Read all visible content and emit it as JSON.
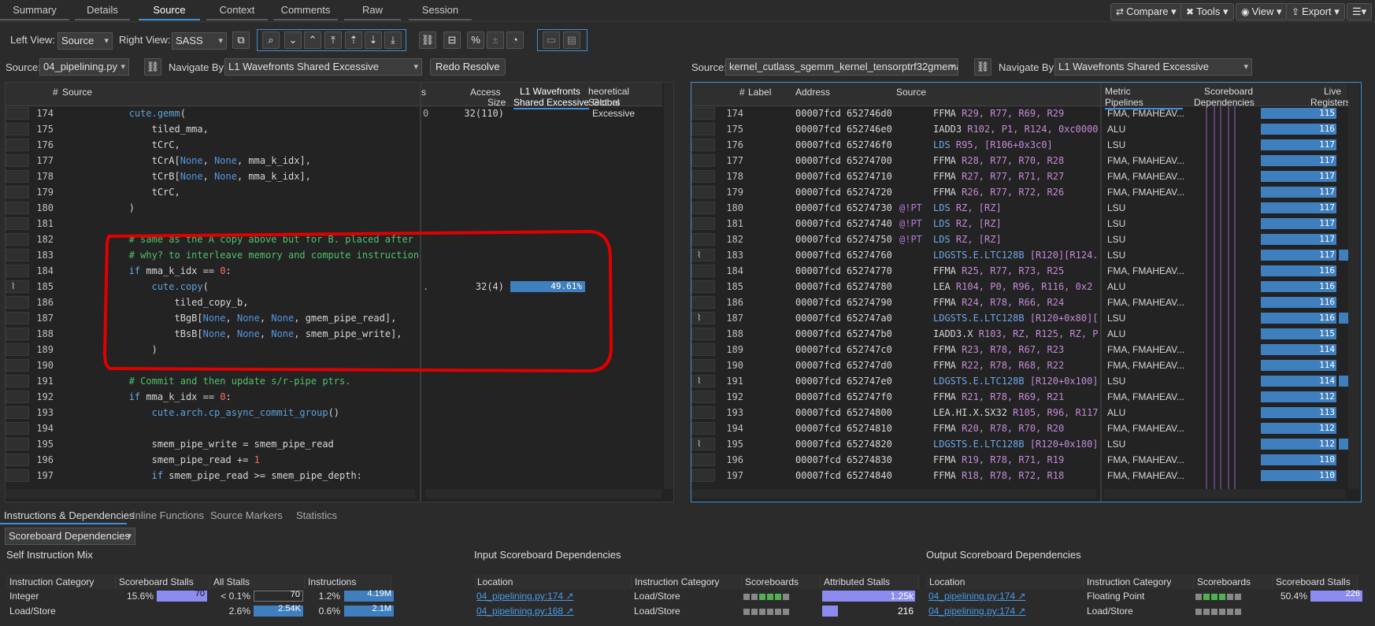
{
  "top_tabs": [
    "Summary",
    "Details",
    "Source",
    "Context",
    "Comments",
    "Raw",
    "Session"
  ],
  "right_buttons": {
    "compare": "Compare",
    "tools": "Tools",
    "view": "View",
    "export": "Export"
  },
  "toolbar": {
    "left_view_label": "Left View:",
    "left_view_value": "Source",
    "right_view_label": "Right View:",
    "right_view_value": "SASS"
  },
  "left_nav": {
    "source_label": "Source:",
    "source_value": "04_pipelining.py",
    "navigate_label": "Navigate By:",
    "navigate_value": "L1 Wavefronts Shared Excessive",
    "redo": "Redo Resolve"
  },
  "right_nav": {
    "source_label": "Source:",
    "source_value": "kernel_cutlass_sgemm_kernel_tensorptrf32gmemal",
    "navigate_label": "Navigate By:",
    "navigate_value": "L1 Wavefronts Shared Excessive"
  },
  "left_headers": {
    "num": "#",
    "source": "Source",
    "access_size_1": "Access",
    "access_size_2": "Size",
    "l1_1": "L1 Wavefronts",
    "l1_2": "Shared Excessive",
    "theo_1": "heoretical Sectors",
    "theo_2": "Global Excessive",
    "s_frag": "s"
  },
  "source_lines": [
    {
      "n": "174",
      "code": [
        [
          "            ",
          ""
        ],
        [
          "cute.gemm",
          "fn"
        ],
        [
          "(",
          ""
        ]
      ],
      "access": "32(110)",
      "frag": "0"
    },
    {
      "n": "175",
      "code": [
        [
          "                tiled_mma,",
          ""
        ]
      ]
    },
    {
      "n": "176",
      "code": [
        [
          "                tCrC,",
          ""
        ]
      ]
    },
    {
      "n": "177",
      "code": [
        [
          "                tCrA[",
          ""
        ],
        [
          "None",
          "none"
        ],
        [
          ", ",
          ""
        ],
        [
          "None",
          "none"
        ],
        [
          ", mma_k_idx],",
          ""
        ]
      ]
    },
    {
      "n": "178",
      "code": [
        [
          "                tCrB[",
          ""
        ],
        [
          "None",
          "none"
        ],
        [
          ", ",
          ""
        ],
        [
          "None",
          "none"
        ],
        [
          ", mma_k_idx],",
          ""
        ]
      ]
    },
    {
      "n": "179",
      "code": [
        [
          "                tCrC,",
          ""
        ]
      ]
    },
    {
      "n": "180",
      "code": [
        [
          "            )",
          ""
        ]
      ]
    },
    {
      "n": "181",
      "code": [
        [
          "",
          ""
        ]
      ]
    },
    {
      "n": "182",
      "code": [
        [
          "            # same as the A copy above but for B. placed after t",
          "cm"
        ]
      ]
    },
    {
      "n": "183",
      "code": [
        [
          "            # why? to interleave memory and compute instructions",
          "cm"
        ]
      ]
    },
    {
      "n": "184",
      "code": [
        [
          "            ",
          ""
        ],
        [
          "if",
          "kw"
        ],
        [
          " mma_k_idx == ",
          ""
        ],
        [
          "0",
          "num"
        ],
        [
          ":",
          ""
        ]
      ]
    },
    {
      "n": "185",
      "code": [
        [
          "                ",
          ""
        ],
        [
          "cute.copy",
          "fn"
        ],
        [
          "(",
          ""
        ]
      ],
      "access": "32(4)",
      "frag": ".",
      "pct": "49.61%",
      "icon": true
    },
    {
      "n": "186",
      "code": [
        [
          "                    tiled_copy_b,",
          ""
        ]
      ]
    },
    {
      "n": "187",
      "code": [
        [
          "                    tBgB[",
          ""
        ],
        [
          "None",
          "none"
        ],
        [
          ", ",
          ""
        ],
        [
          "None",
          "none"
        ],
        [
          ", ",
          ""
        ],
        [
          "None",
          "none"
        ],
        [
          ", gmem_pipe_read],",
          ""
        ]
      ]
    },
    {
      "n": "188",
      "code": [
        [
          "                    tBsB[",
          ""
        ],
        [
          "None",
          "none"
        ],
        [
          ", ",
          ""
        ],
        [
          "None",
          "none"
        ],
        [
          ", ",
          ""
        ],
        [
          "None",
          "none"
        ],
        [
          ", smem_pipe_write],",
          ""
        ]
      ]
    },
    {
      "n": "189",
      "code": [
        [
          "                )",
          ""
        ]
      ]
    },
    {
      "n": "190",
      "code": [
        [
          "",
          ""
        ]
      ]
    },
    {
      "n": "191",
      "code": [
        [
          "            # Commit and then update s/r-pipe ptrs.",
          "cm"
        ]
      ]
    },
    {
      "n": "192",
      "code": [
        [
          "            ",
          ""
        ],
        [
          "if",
          "kw"
        ],
        [
          " mma_k_idx == ",
          ""
        ],
        [
          "0",
          "num"
        ],
        [
          ":",
          ""
        ]
      ]
    },
    {
      "n": "193",
      "code": [
        [
          "                ",
          ""
        ],
        [
          "cute.arch.cp_async_commit_group",
          "fn"
        ],
        [
          "()",
          ""
        ]
      ]
    },
    {
      "n": "194",
      "code": [
        [
          "",
          ""
        ]
      ]
    },
    {
      "n": "195",
      "code": [
        [
          "                smem_pipe_write = smem_pipe_read",
          ""
        ]
      ]
    },
    {
      "n": "196",
      "code": [
        [
          "                smem_pipe_read += ",
          ""
        ],
        [
          "1",
          "num"
        ]
      ]
    },
    {
      "n": "197",
      "code": [
        [
          "                ",
          ""
        ],
        [
          "if",
          "kw"
        ],
        [
          " smem_pipe_read >= smem_pipe_depth:",
          ""
        ]
      ]
    }
  ],
  "right_headers": {
    "num": "#",
    "label": "Label",
    "address": "Address",
    "source": "Source",
    "metric_1": "Metric",
    "metric_2": "Pipelines",
    "sb_1": "Scoreboard",
    "sb_2": "Dependencies",
    "live_1": "Live",
    "live_2": "Registers"
  },
  "sass_lines": [
    {
      "n": "174",
      "addr": "00007fcd 652746d0",
      "pred": "",
      "op": "FFMA",
      "args": " R29, R77, R69, R29",
      "pipe": "FMA, FMAHEAV...",
      "live": "115",
      "ld": false
    },
    {
      "n": "175",
      "addr": "00007fcd 652746e0",
      "pred": "",
      "op": "IADD3",
      "args": " R102, P1, R124, 0xc0000",
      "pipe": "ALU",
      "live": "116",
      "ld": false
    },
    {
      "n": "176",
      "addr": "00007fcd 652746f0",
      "pred": "",
      "op": "LDS",
      "args": " R95, [R106+0x3c0]",
      "pipe": "LSU",
      "live": "117",
      "ld": true
    },
    {
      "n": "177",
      "addr": "00007fcd 65274700",
      "pred": "",
      "op": "FFMA",
      "args": " R28, R77, R70, R28",
      "pipe": "FMA, FMAHEAV...",
      "live": "117",
      "ld": false
    },
    {
      "n": "178",
      "addr": "00007fcd 65274710",
      "pred": "",
      "op": "FFMA",
      "args": " R27, R77, R71, R27",
      "pipe": "FMA, FMAHEAV...",
      "live": "117",
      "ld": false
    },
    {
      "n": "179",
      "addr": "00007fcd 65274720",
      "pred": "",
      "op": "FFMA",
      "args": " R26, R77, R72, R26",
      "pipe": "FMA, FMAHEAV...",
      "live": "117",
      "ld": false
    },
    {
      "n": "180",
      "addr": "00007fcd 65274730",
      "pred": "@!PT",
      "op": "LDS",
      "args": " RZ, [RZ]",
      "pipe": "LSU",
      "live": "117",
      "ld": true
    },
    {
      "n": "181",
      "addr": "00007fcd 65274740",
      "pred": "@!PT",
      "op": "LDS",
      "args": " RZ, [RZ]",
      "pipe": "LSU",
      "live": "117",
      "ld": true
    },
    {
      "n": "182",
      "addr": "00007fcd 65274750",
      "pred": "@!PT",
      "op": "LDS",
      "args": " RZ, [RZ]",
      "pipe": "LSU",
      "live": "117",
      "ld": true
    },
    {
      "n": "183",
      "addr": "00007fcd 65274760",
      "pred": "",
      "op": "LDGSTS.E.LTC128B",
      "args": " [R120][R124.6",
      "pipe": "LSU",
      "live": "117",
      "ld": true,
      "icon": true
    },
    {
      "n": "184",
      "addr": "00007fcd 65274770",
      "pred": "",
      "op": "FFMA",
      "args": " R25, R77, R73, R25",
      "pipe": "FMA, FMAHEAV...",
      "live": "116",
      "ld": false
    },
    {
      "n": "185",
      "addr": "00007fcd 65274780",
      "pred": "",
      "op": "LEA",
      "args": " R104, P0, R96, R116, 0x2",
      "pipe": "ALU",
      "live": "116",
      "ld": false
    },
    {
      "n": "186",
      "addr": "00007fcd 65274790",
      "pred": "",
      "op": "FFMA",
      "args": " R24, R78, R66, R24",
      "pipe": "FMA, FMAHEAV...",
      "live": "116",
      "ld": false
    },
    {
      "n": "187",
      "addr": "00007fcd 652747a0",
      "pred": "",
      "op": "LDGSTS.E.LTC128B",
      "args": " [R120+0x80][R",
      "pipe": "LSU",
      "live": "116",
      "ld": true,
      "icon": true
    },
    {
      "n": "188",
      "addr": "00007fcd 652747b0",
      "pred": "",
      "op": "IADD3.X",
      "args": " R103, RZ, R125, RZ, P",
      "pipe": "ALU",
      "live": "115",
      "ld": false
    },
    {
      "n": "189",
      "addr": "00007fcd 652747c0",
      "pred": "",
      "op": "FFMA",
      "args": " R23, R78, R67, R23",
      "pipe": "FMA, FMAHEAV...",
      "live": "114",
      "ld": false
    },
    {
      "n": "190",
      "addr": "00007fcd 652747d0",
      "pred": "",
      "op": "FFMA",
      "args": " R22, R78, R68, R22",
      "pipe": "FMA, FMAHEAV...",
      "live": "114",
      "ld": false
    },
    {
      "n": "191",
      "addr": "00007fcd 652747e0",
      "pred": "",
      "op": "LDGSTS.E.LTC128B",
      "args": " [R120+0x100][R",
      "pipe": "LSU",
      "live": "114",
      "ld": true,
      "icon": true
    },
    {
      "n": "192",
      "addr": "00007fcd 652747f0",
      "pred": "",
      "op": "FFMA",
      "args": " R21, R78, R69, R21",
      "pipe": "FMA, FMAHEAV...",
      "live": "112",
      "ld": false
    },
    {
      "n": "193",
      "addr": "00007fcd 65274800",
      "pred": "",
      "op": "LEA.HI.X.SX32",
      "args": " R105, R96, R117",
      "pipe": "ALU",
      "live": "113",
      "ld": false
    },
    {
      "n": "194",
      "addr": "00007fcd 65274810",
      "pred": "",
      "op": "FFMA",
      "args": " R20, R78, R70, R20",
      "pipe": "FMA, FMAHEAV...",
      "live": "112",
      "ld": false
    },
    {
      "n": "195",
      "addr": "00007fcd 65274820",
      "pred": "",
      "op": "LDGSTS.E.LTC128B",
      "args": " [R120+0x180][R",
      "pipe": "LSU",
      "live": "112",
      "ld": true,
      "icon": true
    },
    {
      "n": "196",
      "addr": "00007fcd 65274830",
      "pred": "",
      "op": "FFMA",
      "args": " R19, R78, R71, R19",
      "pipe": "FMA, FMAHEAV...",
      "live": "110",
      "ld": false
    },
    {
      "n": "197",
      "addr": "00007fcd 65274840",
      "pred": "",
      "op": "FFMA",
      "args": " R18, R78, R72, R18",
      "pipe": "FMA, FMAHEAV...",
      "live": "110",
      "ld": false
    }
  ],
  "bottom_tabs": [
    "Instructions & Dependencies",
    "Inline Functions",
    "Source Markers",
    "Statistics"
  ],
  "dep_combo": "Scoreboard Dependencies",
  "self_mix": {
    "title": "Self Instruction Mix",
    "headers": [
      "Instruction Category",
      "Scoreboard Stalls",
      "All Stalls",
      "Instructions"
    ],
    "rows": [
      {
        "cat": "Integer",
        "sb_pct": "15.6%",
        "sb_val": "70",
        "all_pct": "< 0.1%",
        "all_val": "70",
        "ins_pct": "1.2%",
        "ins_val": "4.19M"
      },
      {
        "cat": "Load/Store",
        "sb_pct": "",
        "sb_val": "",
        "all_pct": "2.6%",
        "all_val": "2.54K",
        "ins_pct": "0.6%",
        "ins_val": "2.1M"
      }
    ]
  },
  "input_deps": {
    "title": "Input Scoreboard Dependencies",
    "headers": [
      "Location",
      "Instruction Category",
      "Scoreboards",
      "Attributed Stalls"
    ],
    "rows": [
      {
        "loc": "04_pipelining.py:174",
        "cat": "Load/Store",
        "val": "1.25k"
      },
      {
        "loc": "04_pipelining.py:168",
        "cat": "Load/Store",
        "val": "216"
      }
    ]
  },
  "output_deps": {
    "title": "Output Scoreboard Dependencies",
    "headers": [
      "Location",
      "Instruction Category",
      "Scoreboards",
      "Scoreboard Stalls"
    ],
    "rows": [
      {
        "loc": "04_pipelining.py:174",
        "cat": "Floating Point",
        "pct": "50.4%",
        "val": "226"
      },
      {
        "loc": "04_pipelining.py:174",
        "cat": "Load/Store",
        "pct": "",
        "val": ""
      }
    ]
  },
  "colors": {
    "accent": "#3f8fd6",
    "bar": "#3f7fbe",
    "bar_purple": "#8c8cf0",
    "annotation": "#e00000",
    "comment": "#4fc06b",
    "keyword": "#6fa6e6",
    "number": "#ff6a5a",
    "opcode": "#b57bdc"
  }
}
